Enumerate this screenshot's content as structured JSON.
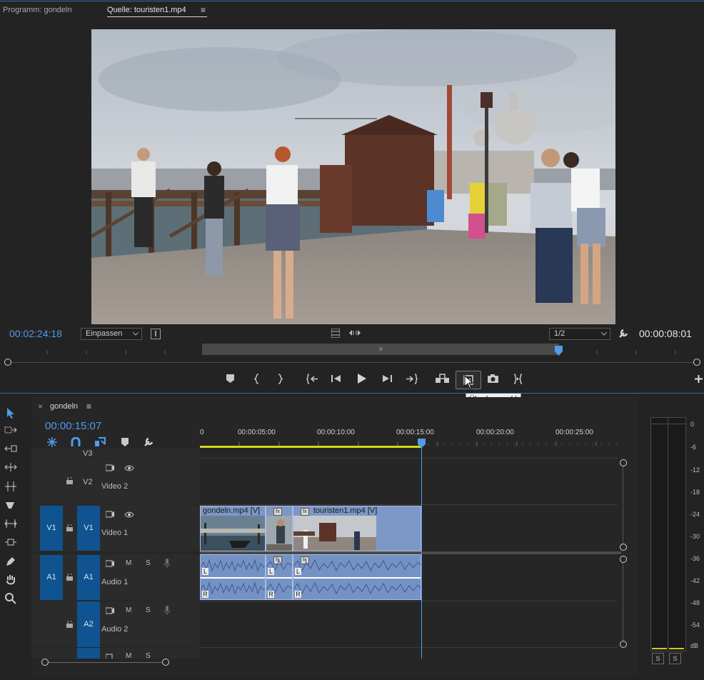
{
  "tabs": {
    "program": "Programm: gondeln",
    "source": "Quelle: touristen1.mp4",
    "source_menu": "≡"
  },
  "source_monitor": {
    "playhead_time": "00:00:08:01",
    "in_time": "00:02:24:18",
    "fit_select": "Einpassen",
    "resolution_select": "1/2",
    "scrub_marker": "ıı"
  },
  "tooltip": "Überlagern (.)",
  "sequence": {
    "tab_label": "gondeln",
    "menu": "≡",
    "close": "×",
    "timecode": "00:00:15:07",
    "ruler": [
      "00:00:05:00",
      "00:00:10:00",
      "00:00:15:00",
      "00:00:20:00",
      "00:00:25:00"
    ],
    "ruler_start": "0"
  },
  "tracks": {
    "v3": "V3",
    "v2": {
      "target": "V2",
      "name": "Video 2"
    },
    "v1": {
      "src": "V1",
      "target": "V1",
      "name": "Video 1"
    },
    "a1": {
      "src": "A1",
      "target": "A1",
      "name": "Audio 1",
      "m": "M",
      "s": "S"
    },
    "a2": {
      "target": "A2",
      "name": "Audio 2",
      "m": "M",
      "s": "S"
    },
    "a3": {
      "m": "M",
      "s": "S"
    }
  },
  "clips": {
    "video": [
      {
        "label": "gondeln.mp4 [V]"
      },
      {
        "label": "fx"
      },
      {
        "label": "touristen1.mp4 [V]"
      }
    ],
    "audio_channels": [
      "L",
      "R"
    ]
  },
  "meter": {
    "scale": [
      "0",
      "-6",
      "-12",
      "-18",
      "-24",
      "-30",
      "-36",
      "-42",
      "-48",
      "-54",
      "dB"
    ],
    "solo_left": "S",
    "solo_right": "S"
  },
  "colors": {
    "accent": "#4f9ce8",
    "timecode": "#4f9ce8",
    "target_fill": "#0f5390",
    "video_clip": "#7d98c6",
    "audio_clip": "#7592c4",
    "work_area": "#d6d61a"
  }
}
